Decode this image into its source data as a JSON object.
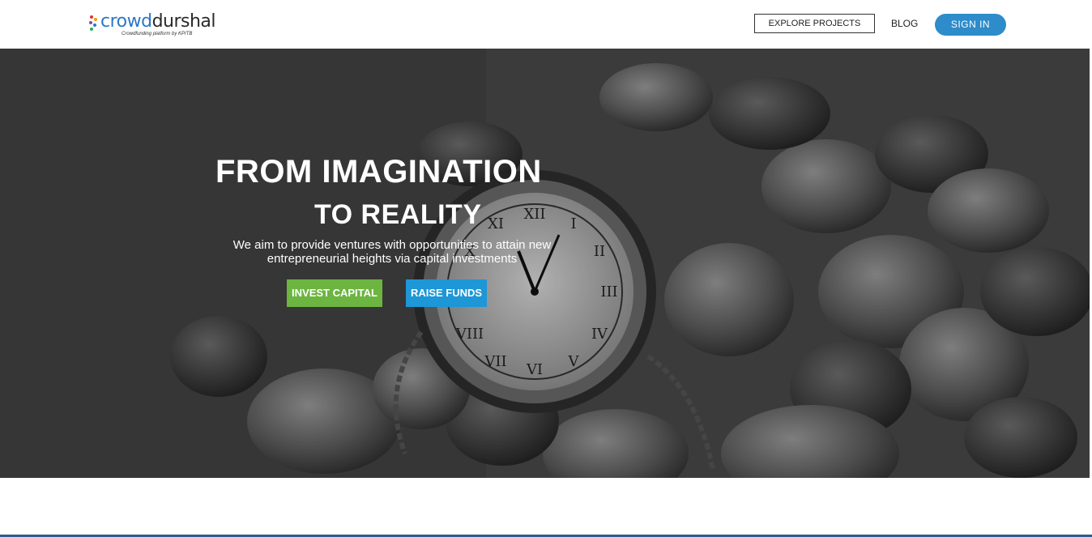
{
  "header": {
    "logo": {
      "word1": "crowd",
      "word2": "durshal",
      "tagline": "Crowdfunding platform by KPITB"
    },
    "nav": {
      "explore_label": "EXPLORE PROJECTS",
      "blog_label": "BLOG",
      "signin_label": "SIGN IN"
    }
  },
  "hero": {
    "title_line1": "FROM IMAGINATION",
    "title_line2": "TO REALITY",
    "subtitle": "We aim to provide ventures with opportunities to attain new entrepreneurial heights via capital investments",
    "invest_label": "INVEST CAPITAL",
    "raise_label": "RAISE FUNDS",
    "background_image": "pocket-watch-and-coins"
  },
  "colors": {
    "brand_blue": "#2b78c5",
    "signin_blue": "#2d8cc9",
    "invest_green": "#6cb540",
    "raise_blue": "#1d97d6"
  }
}
